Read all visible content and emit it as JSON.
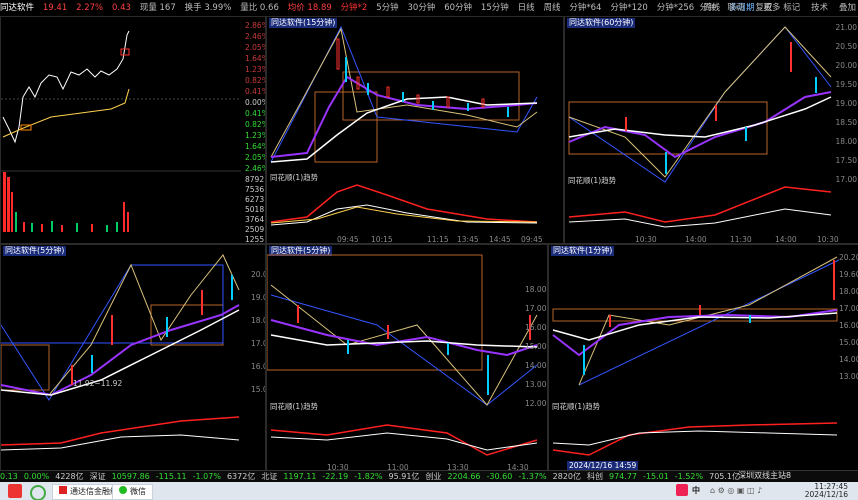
{
  "top_bar": {
    "title": "同达软件",
    "quote": [
      "19.41",
      "2.27%",
      "0.43",
      "现量 167",
      "换手 3.99%",
      "量比 0.66",
      "均价 18.89"
    ],
    "periods": [
      "分钟*2",
      "5分钟",
      "30分钟",
      "60分钟",
      "15分钟",
      "日线",
      "周线",
      "分钟*64",
      "分钟*120",
      "分钟*256"
    ],
    "active_period": "分钟*2",
    "tools": [
      "周线",
      "多周期",
      "更多"
    ],
    "right_tools": [
      "分钟",
      "联动",
      "复权",
      "标记",
      "技术",
      "叠加"
    ]
  },
  "left_axis_labels": [
    "2.86%",
    "2.46%",
    "2.05%",
    "1.64%",
    "1.23%",
    "0.82%",
    "0.41%",
    "0.00%",
    "0.41%",
    "0.82%",
    "1.23%",
    "1.64%",
    "2.05%",
    "2.46%"
  ],
  "volume_axis_labels": [
    "8792",
    "7536",
    "6273",
    "5018",
    "3764",
    "2509",
    "1255"
  ],
  "panels": [
    {
      "title": "同达软件(15分钟)",
      "sub": "同花顺(1)趋势",
      "times": [
        "09:45",
        "10:15",
        "11:15",
        "13:45",
        "14:45",
        "09:45"
      ]
    },
    {
      "title": "同达软件(60分钟)",
      "sub": "同花顺(1)趋势",
      "prices": [
        "21.00",
        "20.50",
        "20.00",
        "19.50",
        "19.00",
        "18.50",
        "18.00",
        "17.50",
        "17.00"
      ],
      "times": [
        "10:30",
        "14:00",
        "11:30",
        "14:00",
        "10:30"
      ]
    },
    {
      "title": "同达软件(5分钟)",
      "sub": "",
      "prices": [
        "20.00",
        "19.00",
        "18.00",
        "17.00",
        "16.00",
        "15.00"
      ],
      "annot": "11.92~11.92"
    },
    {
      "title": "同达软件(5分钟)",
      "sub": "同花顺(1)趋势",
      "prices": [
        "18.00",
        "17.00",
        "16.00",
        "15.00",
        "14.00",
        "13.00",
        "12.00"
      ],
      "times": [
        "10:30",
        "11:00",
        "13:30",
        "14:30"
      ]
    },
    {
      "title": "同达软件(1分钟)",
      "sub": "同花顺(1)趋势",
      "prices": [
        "20.20",
        "19.60",
        "18.00",
        "17.00",
        "16.00",
        "15.00",
        "14.00",
        "13.00"
      ],
      "date": "2024/12/16 14:59"
    }
  ],
  "status_bar": [
    {
      "label": "0.13",
      "color": "#33dd33"
    },
    {
      "label": "0.00%",
      "color": "#33dd33"
    },
    {
      "label": "4228亿",
      "color": "#cccccc"
    },
    {
      "label": "深证",
      "color": "#cccccc"
    },
    {
      "label": "10597.86",
      "color": "#33dd33"
    },
    {
      "label": "-115.11",
      "color": "#33dd33"
    },
    {
      "label": "-1.07%",
      "color": "#33dd33"
    },
    {
      "label": "6372亿",
      "color": "#cccccc"
    },
    {
      "label": "北证",
      "color": "#cccccc"
    },
    {
      "label": "1197.11",
      "color": "#33dd33"
    },
    {
      "label": "-22.19",
      "color": "#33dd33"
    },
    {
      "label": "-1.82%",
      "color": "#33dd33"
    },
    {
      "label": "95.91亿",
      "color": "#cccccc"
    },
    {
      "label": "创业",
      "color": "#cccccc"
    },
    {
      "label": "2204.66",
      "color": "#33dd33"
    },
    {
      "label": "-30.60",
      "color": "#33dd33"
    },
    {
      "label": "-1.37%",
      "color": "#33dd33"
    },
    {
      "label": "2820亿",
      "color": "#cccccc"
    },
    {
      "label": "科创",
      "color": "#cccccc"
    },
    {
      "label": "974.77",
      "color": "#33dd33"
    },
    {
      "label": "-15.01",
      "color": "#33dd33"
    },
    {
      "label": "-1.52%",
      "color": "#33dd33"
    },
    {
      "label": "705.1亿",
      "color": "#cccccc"
    }
  ],
  "status_right": "深圳双线主站8",
  "taskbar": {
    "app1": "通达信金融终端V7...",
    "app2": "微信",
    "clock_time": "11:27:45",
    "clock_date": "2024/12/16",
    "lang": "中"
  },
  "colors": {
    "up": "#ff3030",
    "down": "#00ccff",
    "ma_purple": "#9933ff",
    "ma_white": "#ffffff",
    "ma_yellow": "#ffd24d",
    "frame_orange": "#b8642a",
    "zz_blue": "#3355ff"
  }
}
